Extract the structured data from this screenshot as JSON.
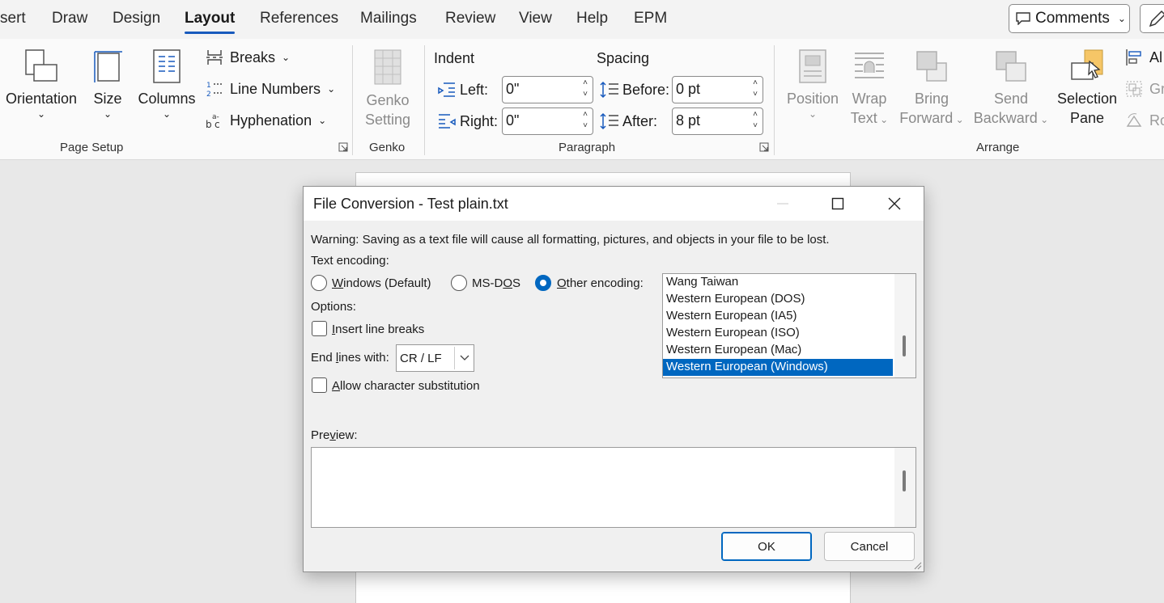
{
  "tabs": [
    "sert",
    "Draw",
    "Design",
    "Layout",
    "References",
    "Mailings",
    "Review",
    "View",
    "Help",
    "EPM"
  ],
  "active_tab": "Layout",
  "comments_label": "Comments",
  "page_setup": {
    "orientation": "Orientation",
    "size": "Size",
    "columns": "Columns",
    "breaks": "Breaks",
    "line_numbers": "Line Numbers",
    "hyphenation": "Hyphenation",
    "group": "Page Setup"
  },
  "genko": {
    "line1": "Genko",
    "line2": "Setting",
    "group": "Genko"
  },
  "paragraph": {
    "indent": "Indent",
    "spacing": "Spacing",
    "left_label": "Left:",
    "left_value": "0\"",
    "right_label": "Right:",
    "right_value": "0\"",
    "before_label": "Before:",
    "before_value": "0 pt",
    "after_label": "After:",
    "after_value": "8 pt",
    "group": "Paragraph"
  },
  "arrange": {
    "position": "Position",
    "wrap_line1": "Wrap",
    "wrap_line2": "Text",
    "bring_line1": "Bring",
    "bring_line2": "Forward",
    "send_line1": "Send",
    "send_line2": "Backward",
    "selection_line1": "Selection",
    "selection_line2": "Pane",
    "align": "Al",
    "group_btn": "Gr",
    "rotate": "Ro",
    "group": "Arrange"
  },
  "dialog": {
    "title": "File Conversion - Test plain.txt",
    "warning": "Warning: Saving as a text file will cause all formatting, pictures, and objects in your file to be lost.",
    "text_encoding_label": "Text encoding:",
    "radio_windows_u": "W",
    "radio_windows_rest": "indows (Default)",
    "radio_msdos_pre": "MS-D",
    "radio_msdos_u": "O",
    "radio_msdos_rest": "S",
    "radio_other_u": "O",
    "radio_other_rest": "ther encoding:",
    "selected_encoding": "Western European (Windows)",
    "encodings": [
      "Wang Taiwan",
      "Western European (DOS)",
      "Western European (IA5)",
      "Western European (ISO)",
      "Western European (Mac)",
      "Western European (Windows)"
    ],
    "options_label": "Options:",
    "insert_breaks_u": "I",
    "insert_breaks_rest": "nsert line breaks",
    "end_lines_pre": "End ",
    "end_lines_u": "l",
    "end_lines_rest": "ines with:",
    "end_lines_value": "CR / LF",
    "allow_sub_u": "A",
    "allow_sub_rest": "llow character substitution",
    "preview_pre": "Pre",
    "preview_u": "v",
    "preview_rest": "iew:",
    "ok": "OK",
    "cancel": "Cancel"
  }
}
